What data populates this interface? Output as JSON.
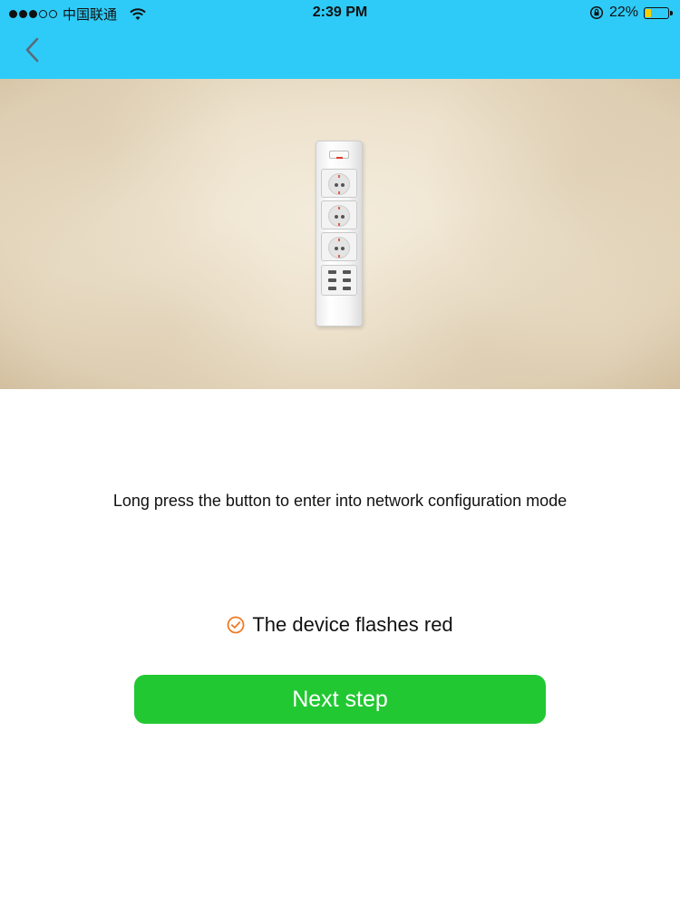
{
  "status_bar": {
    "carrier": "中国联通",
    "time": "2:39 PM",
    "battery": "22%",
    "battery_level": 0.22,
    "icons": [
      "signal-dots",
      "wifi-icon",
      "rotation-lock-icon",
      "battery-icon"
    ]
  },
  "header": {
    "back_icon": "chevron-left-icon",
    "color": "#2ecbf8"
  },
  "hero": {
    "image": "power-strip-device"
  },
  "main": {
    "instruction": "Long press the button to enter into network configuration mode",
    "status_text": "The device flashes red",
    "status_icon": "check-circle-icon",
    "next_button_label": "Next step"
  },
  "colors": {
    "accent": "#2ecbf8",
    "button": "#22c832",
    "check": "#f07a24"
  }
}
